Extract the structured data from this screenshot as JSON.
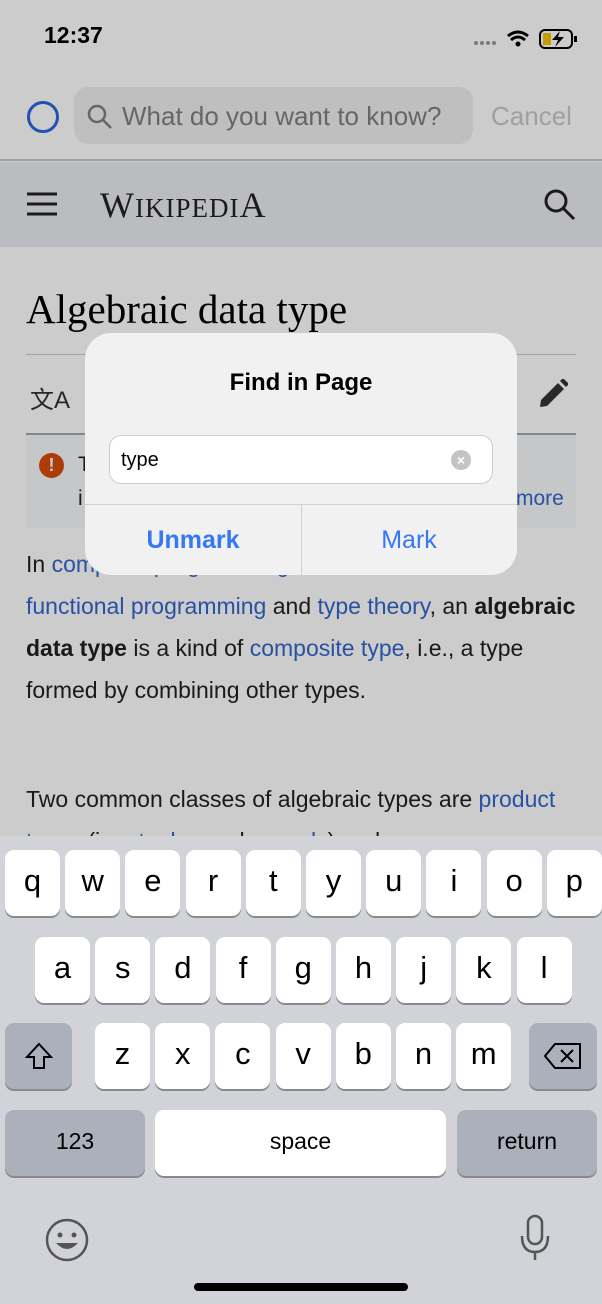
{
  "status": {
    "time": "12:37"
  },
  "search": {
    "placeholder": "What do you want to know?",
    "cancel": "Cancel"
  },
  "wiki": {
    "logo_big1": "W",
    "logo_small": "IKIPEDI",
    "logo_big2": "A",
    "title": "Algebraic data type"
  },
  "notice": {
    "line1": "T",
    "line2": "i",
    "more": "more"
  },
  "article": {
    "p1_in": "In ",
    "p1_link1": "computer programming",
    "p1_sep": ", ",
    "p1_link2": "functional programming",
    "p1_and": " and ",
    "p1_link3": "type theory",
    "p1_an": ", an ",
    "p1_bold": "algebraic data type",
    "p1_mid": " is a kind of ",
    "p1_link4": "composite type",
    "p1_end": ", i.e., a type formed by combining other types.",
    "p2": "Two common classes of algebraic types are ",
    "p2_link1": "product types",
    "p2_mid": " (i.e., ",
    "p2_link2": "tuples",
    "p2_and": " and ",
    "p2_link3": "records",
    "p2_end": ") and"
  },
  "dialog": {
    "title": "Find in Page",
    "value": "type",
    "unmark": "Unmark",
    "mark": "Mark"
  },
  "keyboard": {
    "row1": [
      "q",
      "w",
      "e",
      "r",
      "t",
      "y",
      "u",
      "i",
      "o",
      "p"
    ],
    "row2": [
      "a",
      "s",
      "d",
      "f",
      "g",
      "h",
      "j",
      "k",
      "l"
    ],
    "row3": [
      "z",
      "x",
      "c",
      "v",
      "b",
      "n",
      "m"
    ],
    "numbers": "123",
    "space": "space",
    "return": "return"
  },
  "colors": {
    "accent": "#3478f6",
    "link": "#3366cc",
    "warning": "#d84d0c"
  }
}
